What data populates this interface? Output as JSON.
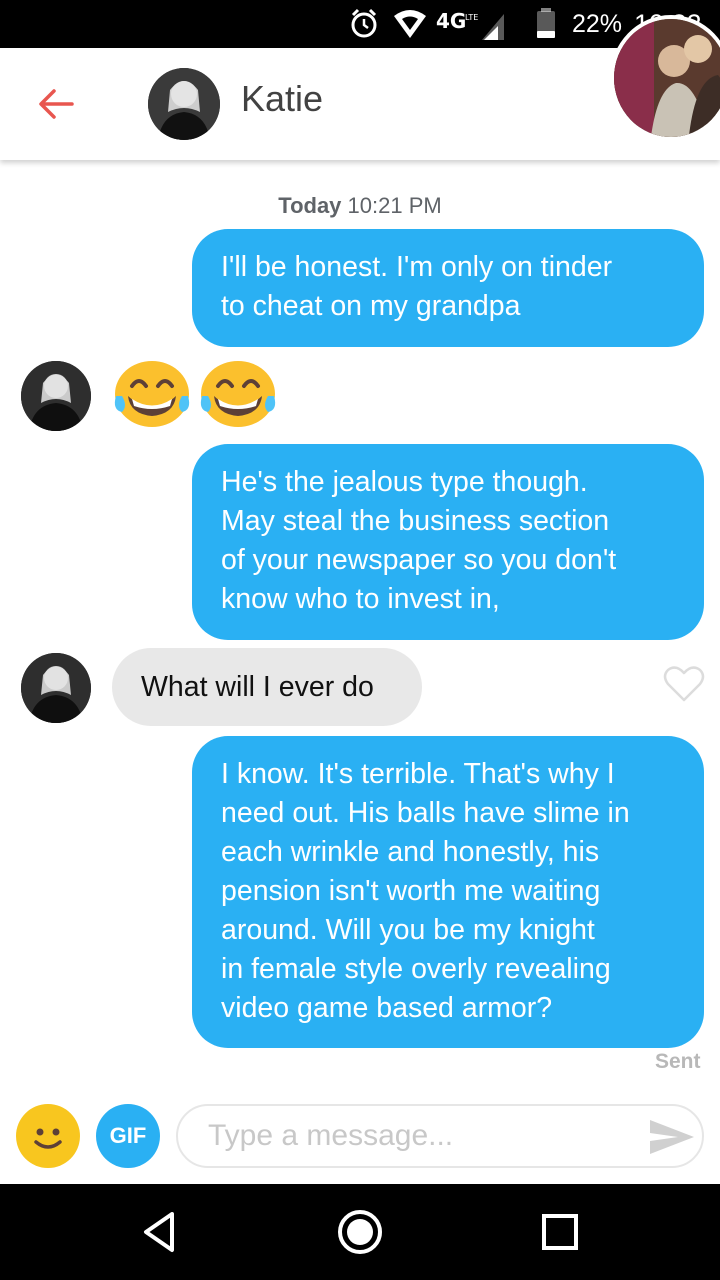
{
  "status_bar": {
    "network": "4G",
    "battery_percent": "22%",
    "time": "10:32",
    "icons": [
      "alarm-icon",
      "wifi-icon",
      "4g-lte-icon",
      "signal-icon",
      "battery-icon"
    ]
  },
  "header": {
    "back_icon": "arrow-left-icon",
    "name": "Katie",
    "accent_color": "#e8564f"
  },
  "chat": {
    "timestamp_day": "Today",
    "timestamp_time": "10:21 PM",
    "messages": [
      {
        "from": "me",
        "lines": [
          "I'll be honest. I'm only on tinder",
          "to cheat on my grandpa"
        ]
      },
      {
        "from": "them",
        "emoji": [
          "face-with-tears-of-joy",
          "face-with-tears-of-joy"
        ]
      },
      {
        "from": "me",
        "lines": [
          "He's the jealous type though.",
          "May steal the business section",
          "of your newspaper so you don't",
          "know who to invest in,"
        ]
      },
      {
        "from": "them",
        "text": "What will I ever do"
      },
      {
        "from": "me",
        "lines": [
          "I know. It's terrible. That's why I",
          "need out. His balls have slime in",
          "each wrinkle and honestly, his",
          "pension isn't worth me waiting",
          "around. Will you be my knight",
          "in female style overly revealing",
          "video game based armor?"
        ]
      }
    ],
    "status": "Sent",
    "bubble_out_color": "#2ab0f3",
    "bubble_in_color": "#e8e8e8"
  },
  "composer": {
    "gif_label": "GIF",
    "placeholder": "Type a message...",
    "value": ""
  }
}
